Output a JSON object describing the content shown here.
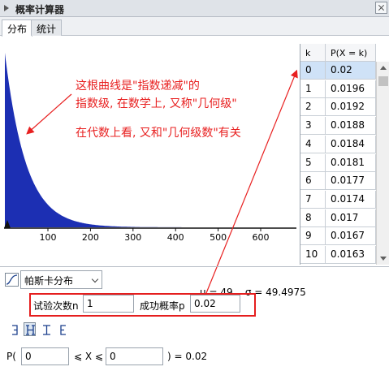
{
  "window": {
    "title": "概率计算器"
  },
  "tabs": [
    {
      "label": "分布"
    },
    {
      "label": "统计"
    }
  ],
  "plot": {
    "stats_label": "μ = 49    σ = 49.4975",
    "fill_color": "#1c2fb3",
    "x_ticks": [
      "100",
      "200",
      "300",
      "400",
      "500",
      "600"
    ]
  },
  "annotations": {
    "line1": "这根曲线是\"指数递减\"的",
    "line2": "指数级, 在数学上, 又称\"几何级\"",
    "line3": "在代数上看, 又和\"几何级数\"有关",
    "color": "#e82020"
  },
  "table": {
    "headers": {
      "k": "k",
      "p": "P(X = k)"
    },
    "rows": [
      {
        "k": "0",
        "p": "0.02"
      },
      {
        "k": "1",
        "p": "0.0196"
      },
      {
        "k": "2",
        "p": "0.0192"
      },
      {
        "k": "3",
        "p": "0.0188"
      },
      {
        "k": "4",
        "p": "0.0184"
      },
      {
        "k": "5",
        "p": "0.0181"
      },
      {
        "k": "6",
        "p": "0.0177"
      },
      {
        "k": "7",
        "p": "0.0174"
      },
      {
        "k": "8",
        "p": "0.017"
      },
      {
        "k": "9",
        "p": "0.0167"
      },
      {
        "k": "10",
        "p": "0.0163"
      }
    ],
    "selected_row": 0
  },
  "distribution": {
    "selected": "帕斯卡分布"
  },
  "params": {
    "trials_label": "试验次数n",
    "trials_value": "1",
    "prob_label": "成功概率p",
    "prob_value": "0.02"
  },
  "probability": {
    "prefix": "P(",
    "lower": "0",
    "middle": "⩽ X ⩽",
    "upper": "0",
    "result": ") =  0.02"
  }
}
